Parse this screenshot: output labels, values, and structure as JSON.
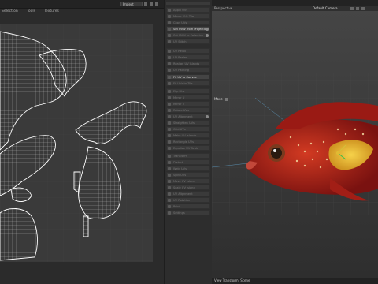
{
  "uv_editor": {
    "menu": [
      "Selection",
      "Tools",
      "Textures"
    ],
    "project_select": "Project"
  },
  "commands": [
    {
      "label": "Apply UVs",
      "active": false
    },
    {
      "label": "Mirror UVs Tile",
      "active": false
    },
    {
      "label": "Copy UVs",
      "active": false
    },
    {
      "label": "Set UVW from Projection",
      "active": true
    },
    {
      "label": "Set UVW to Selection",
      "active": false
    },
    {
      "label": "UV Stitch",
      "active": false
    },
    {
      "label": "UV Relax",
      "active": false
    },
    {
      "label": "UV Peeler",
      "active": false
    },
    {
      "label": "Realign UV Islands",
      "active": false
    },
    {
      "label": "UV Packing",
      "active": false
    },
    {
      "label": "Fit UV to Canvas",
      "active": true
    },
    {
      "label": "Fit UVs to Tile",
      "active": false
    },
    {
      "label": "Flip UVs",
      "active": false
    },
    {
      "label": "Mirror U",
      "active": false
    },
    {
      "label": "Mirror V",
      "active": false
    },
    {
      "label": "Rotate UVs",
      "active": false
    },
    {
      "label": "UV Alignment",
      "active": false
    },
    {
      "label": "Straighten UVs",
      "active": false
    },
    {
      "label": "Grid UVs",
      "active": false
    },
    {
      "label": "Make UV Islands",
      "active": false
    },
    {
      "label": "Rectangle UVs",
      "active": false
    },
    {
      "label": "Equalize UV Scale",
      "active": false
    },
    {
      "label": "Transform",
      "active": false
    },
    {
      "label": "Distort",
      "active": false
    },
    {
      "label": "Weld UVs",
      "active": false
    },
    {
      "label": "Split UVs",
      "active": false
    },
    {
      "label": "Move UV Island",
      "active": false
    },
    {
      "label": "Scale UV Island",
      "active": false
    },
    {
      "label": "UV Alignment",
      "active": false
    },
    {
      "label": "UV Rotation",
      "active": false
    },
    {
      "label": "Paint",
      "active": false
    },
    {
      "label": "Settings",
      "active": false
    }
  ],
  "viewport": {
    "menu": [
      "View",
      "Cameras",
      "Display",
      "Options",
      "Filter",
      "Panel"
    ],
    "view_name": "Perspective",
    "camera": "Default Camera",
    "move_label": "Move",
    "status": "View Transform: Scene"
  },
  "colors": {
    "accent": "#e0bb33",
    "fish_body": "#b22a1a",
    "fish_belly": "#f2c33a"
  }
}
